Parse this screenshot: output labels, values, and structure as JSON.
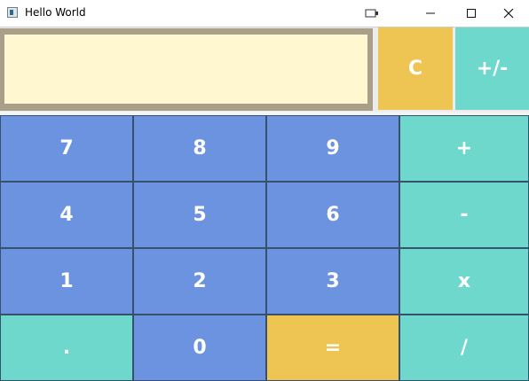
{
  "window": {
    "title": "Hello World"
  },
  "display": {
    "value": ""
  },
  "top_buttons": {
    "clear": "C",
    "negate": "+/-"
  },
  "keys": {
    "seven": "7",
    "eight": "8",
    "nine": "9",
    "plus": "+",
    "four": "4",
    "five": "5",
    "six": "6",
    "minus": "-",
    "one": "1",
    "two": "2",
    "three": "3",
    "times": "x",
    "dot": ".",
    "zero": "0",
    "equals": "=",
    "divide": "/"
  },
  "colors": {
    "digit": "#6b93df",
    "operator": "#6fd8cd",
    "accent": "#eec552",
    "display_bg": "#fff7cf",
    "display_border": "#aaa089"
  }
}
